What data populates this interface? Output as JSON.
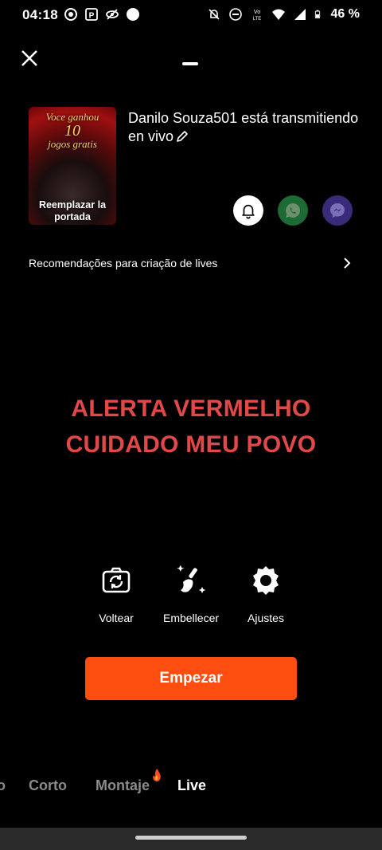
{
  "status_bar": {
    "time": "04:18",
    "battery": "46 %",
    "left_icons": [
      "record-icon",
      "parking-icon",
      "no-eye-icon",
      "circle-icon"
    ],
    "right_icons": [
      "bell-off-icon",
      "dnd-icon",
      "volte-icon",
      "wifi-icon",
      "signal-icon",
      "battery-icon"
    ]
  },
  "cover": {
    "title_line1": "Voce ganhou",
    "title_num": "10",
    "title_line2": "jogos gratis",
    "label": "Reemplazar la portada"
  },
  "headline": "Danilo Souza501 está transmitiendo en vivo",
  "share": [
    "bell-icon",
    "whatsapp-icon",
    "messenger-icon"
  ],
  "recommendations": "Recomendações para criação de lives",
  "alert": {
    "line1": "ALERTA VERMELHO",
    "line2": "CUIDADO MEU POVO",
    "color": "#e24848"
  },
  "tools": [
    {
      "label": "Voltear",
      "icon": "flip-camera-icon"
    },
    {
      "label": "Embellecer",
      "icon": "beauty-brush-icon"
    },
    {
      "label": "Ajustes",
      "icon": "settings-gear-icon"
    }
  ],
  "start_button": "Empezar",
  "accent_color": "#fe4e0f",
  "modes": [
    {
      "label": "o",
      "active": false
    },
    {
      "label": "Corto",
      "active": false
    },
    {
      "label": "Montaje",
      "active": false
    },
    {
      "label": "Live",
      "active": true
    }
  ]
}
